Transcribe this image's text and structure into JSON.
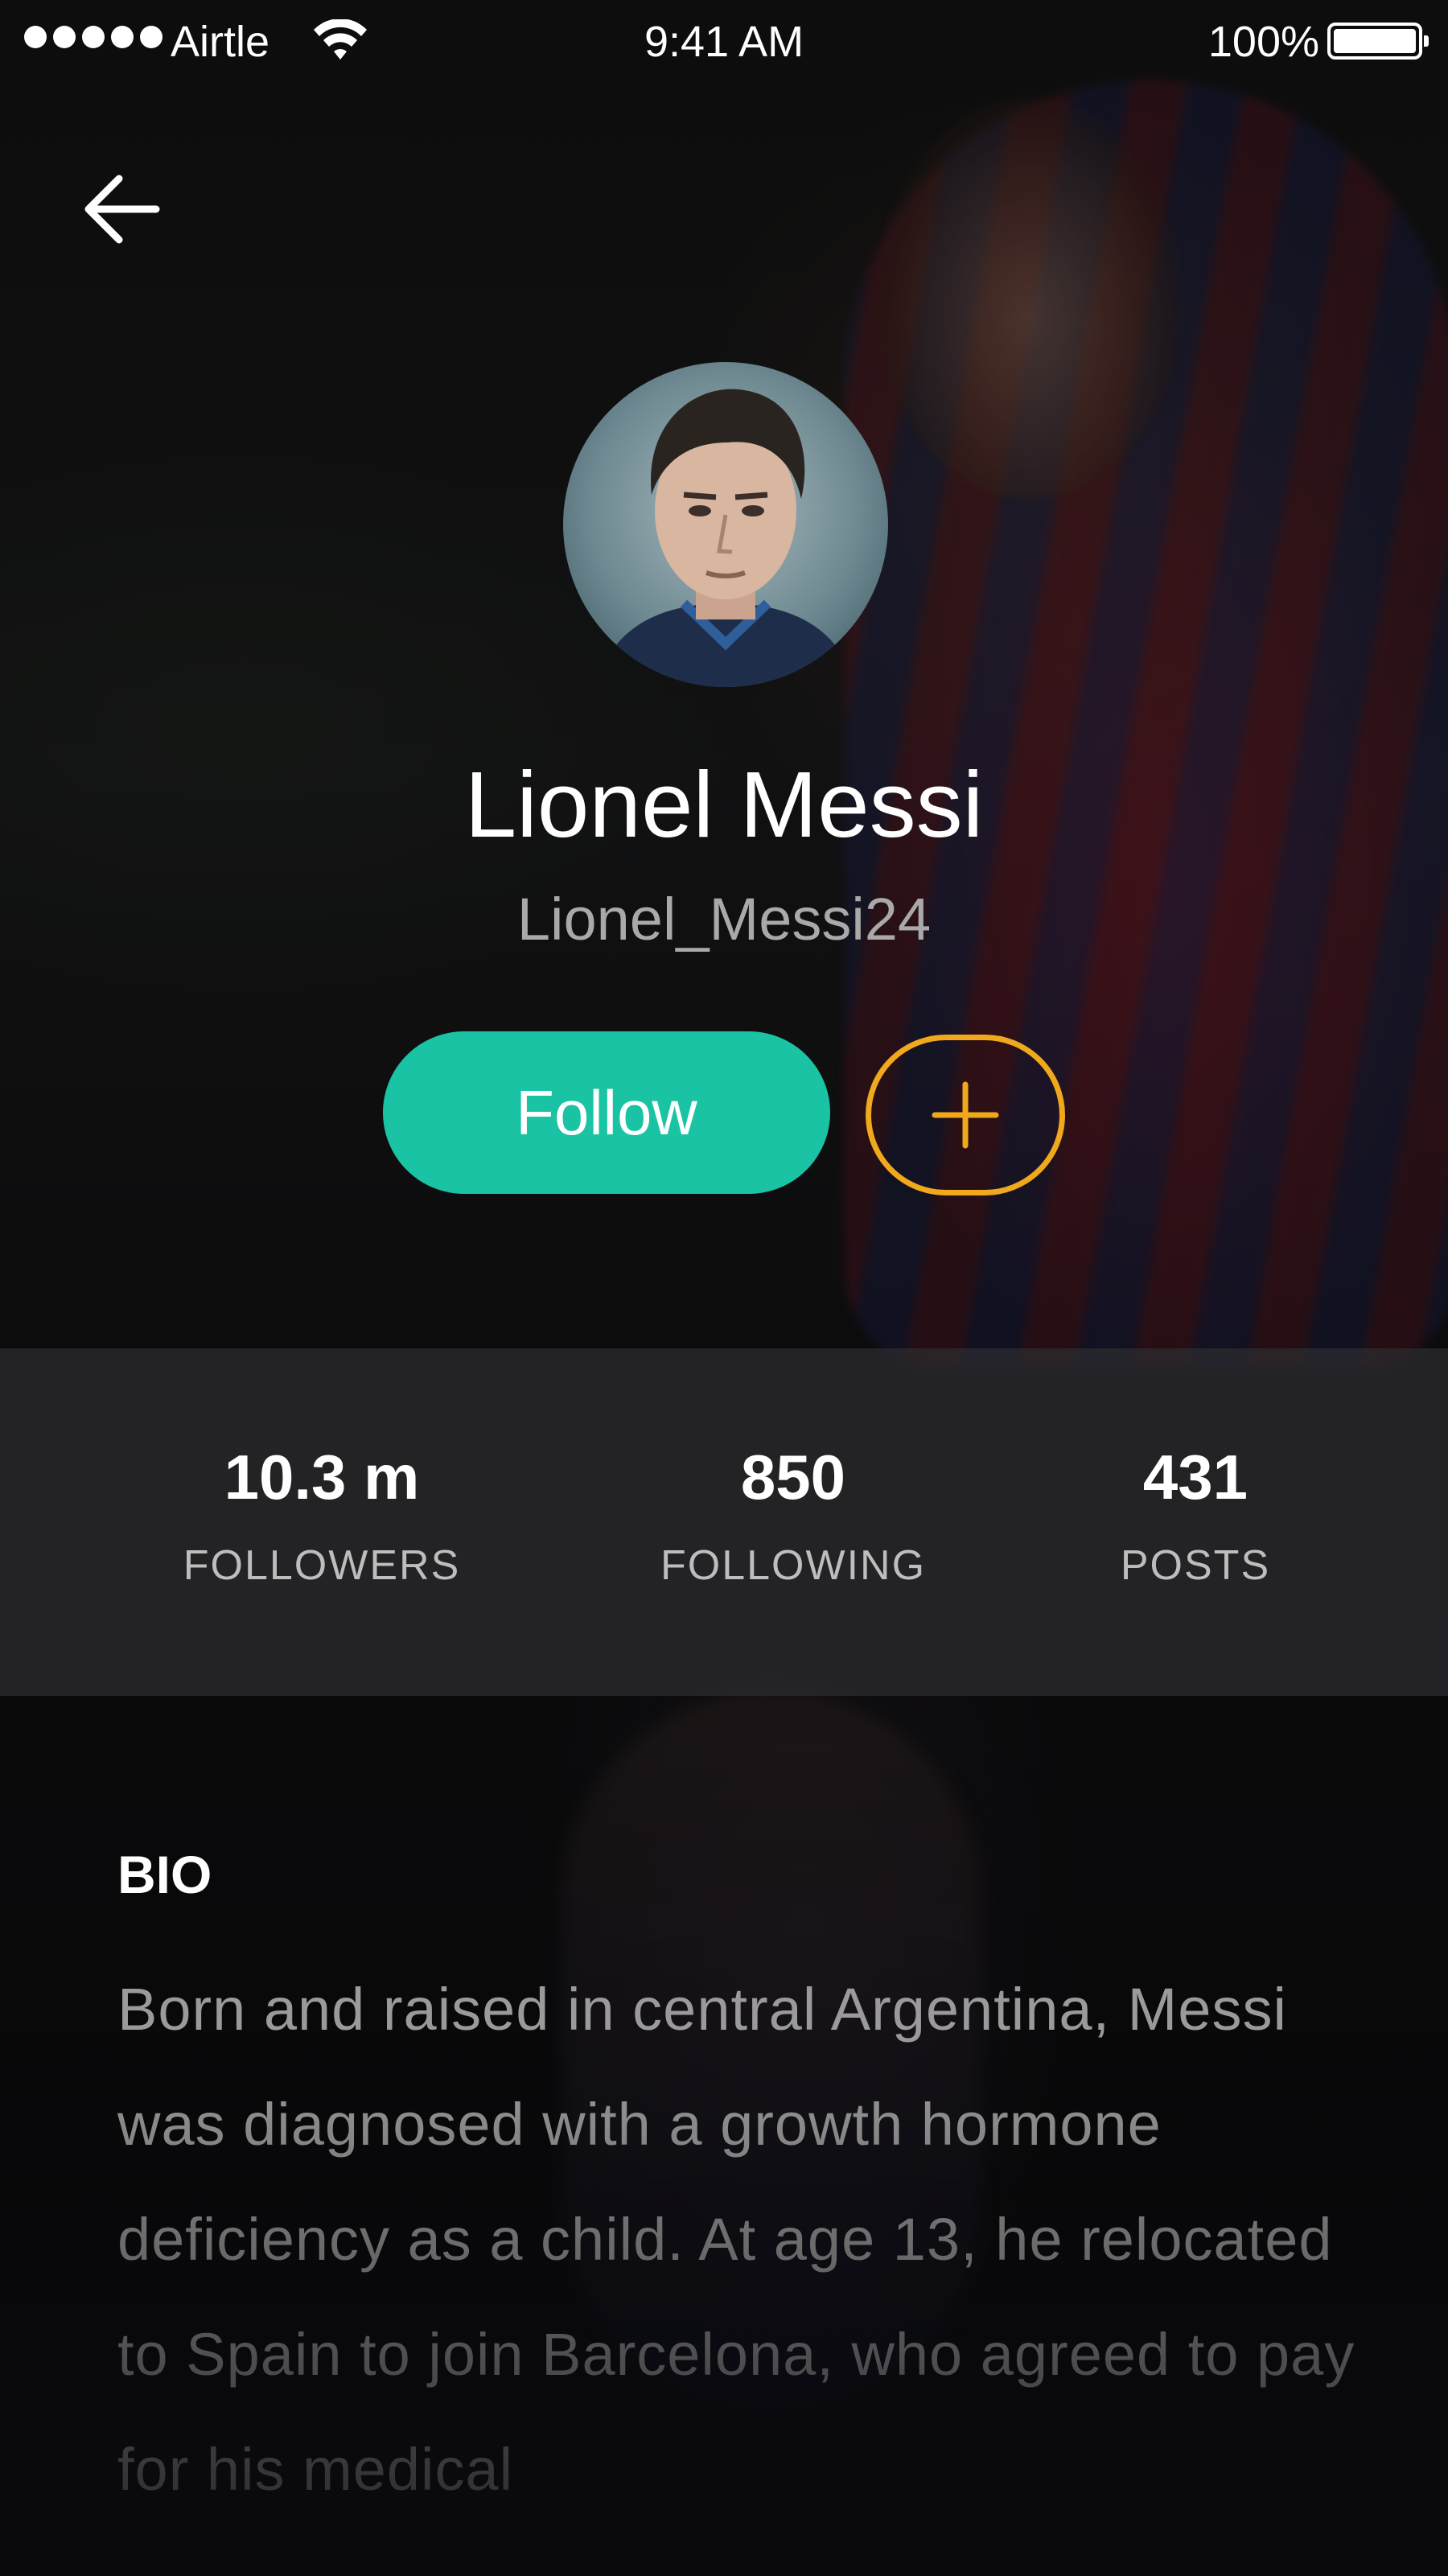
{
  "status_bar": {
    "carrier": "Airtle",
    "time": "9:41 AM",
    "battery_percent": "100%",
    "battery_level": 1.0,
    "signal_bars": 5
  },
  "profile": {
    "name": "Lionel Messi",
    "username": "Lionel_Messi24"
  },
  "actions": {
    "follow_label": "Follow",
    "add_icon": "plus-icon",
    "follow_color": "#19c3a3",
    "add_color": "#f0a81d"
  },
  "stats": {
    "followers": {
      "value": "10.3 m",
      "label": "FOLLOWERS"
    },
    "following": {
      "value": "850",
      "label": "FOLLOWING"
    },
    "posts": {
      "value": "431",
      "label": "POSTS"
    }
  },
  "bio": {
    "heading": "BIO",
    "text": "Born and raised in central Argentina, Messi was diagnosed with a growth hormone deficiency as a child. At age 13, he relocated to Spain to join Barcelona, who agreed to pay for his medical"
  },
  "icons": {
    "back": "arrow-left-icon",
    "wifi": "wifi-icon",
    "battery": "battery-icon"
  }
}
